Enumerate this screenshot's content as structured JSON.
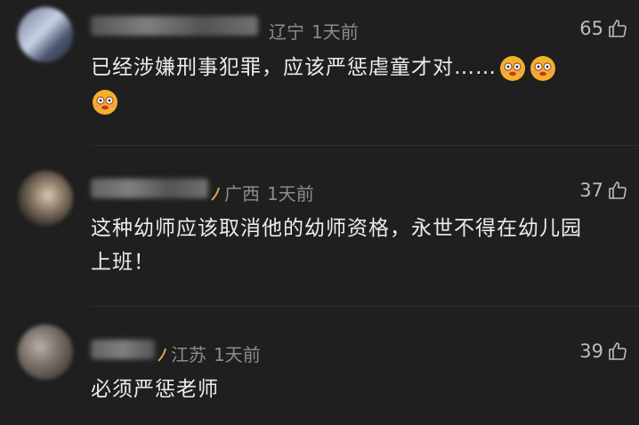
{
  "comments": [
    {
      "region": "辽宁",
      "time": "1天前",
      "likes": "65",
      "text": "已经涉嫌刑事犯罪，应该严惩虐童才对……",
      "emoji_count": 3
    },
    {
      "region": "广西",
      "time": "1天前",
      "likes": "37",
      "text": "这种幼师应该取消他的幼师资格，永世不得在幼儿园上班！"
    },
    {
      "region": "江苏",
      "time": "1天前",
      "likes": "39",
      "text": "必须严惩老师"
    }
  ],
  "icons": {
    "like": "thumbs-up-icon",
    "emoji": "face-emoji-icon"
  },
  "colors": {
    "background": "#1f1f1f",
    "meta": "#8c8c8c",
    "text": "#ececec",
    "emoji": "#f4b02a"
  }
}
